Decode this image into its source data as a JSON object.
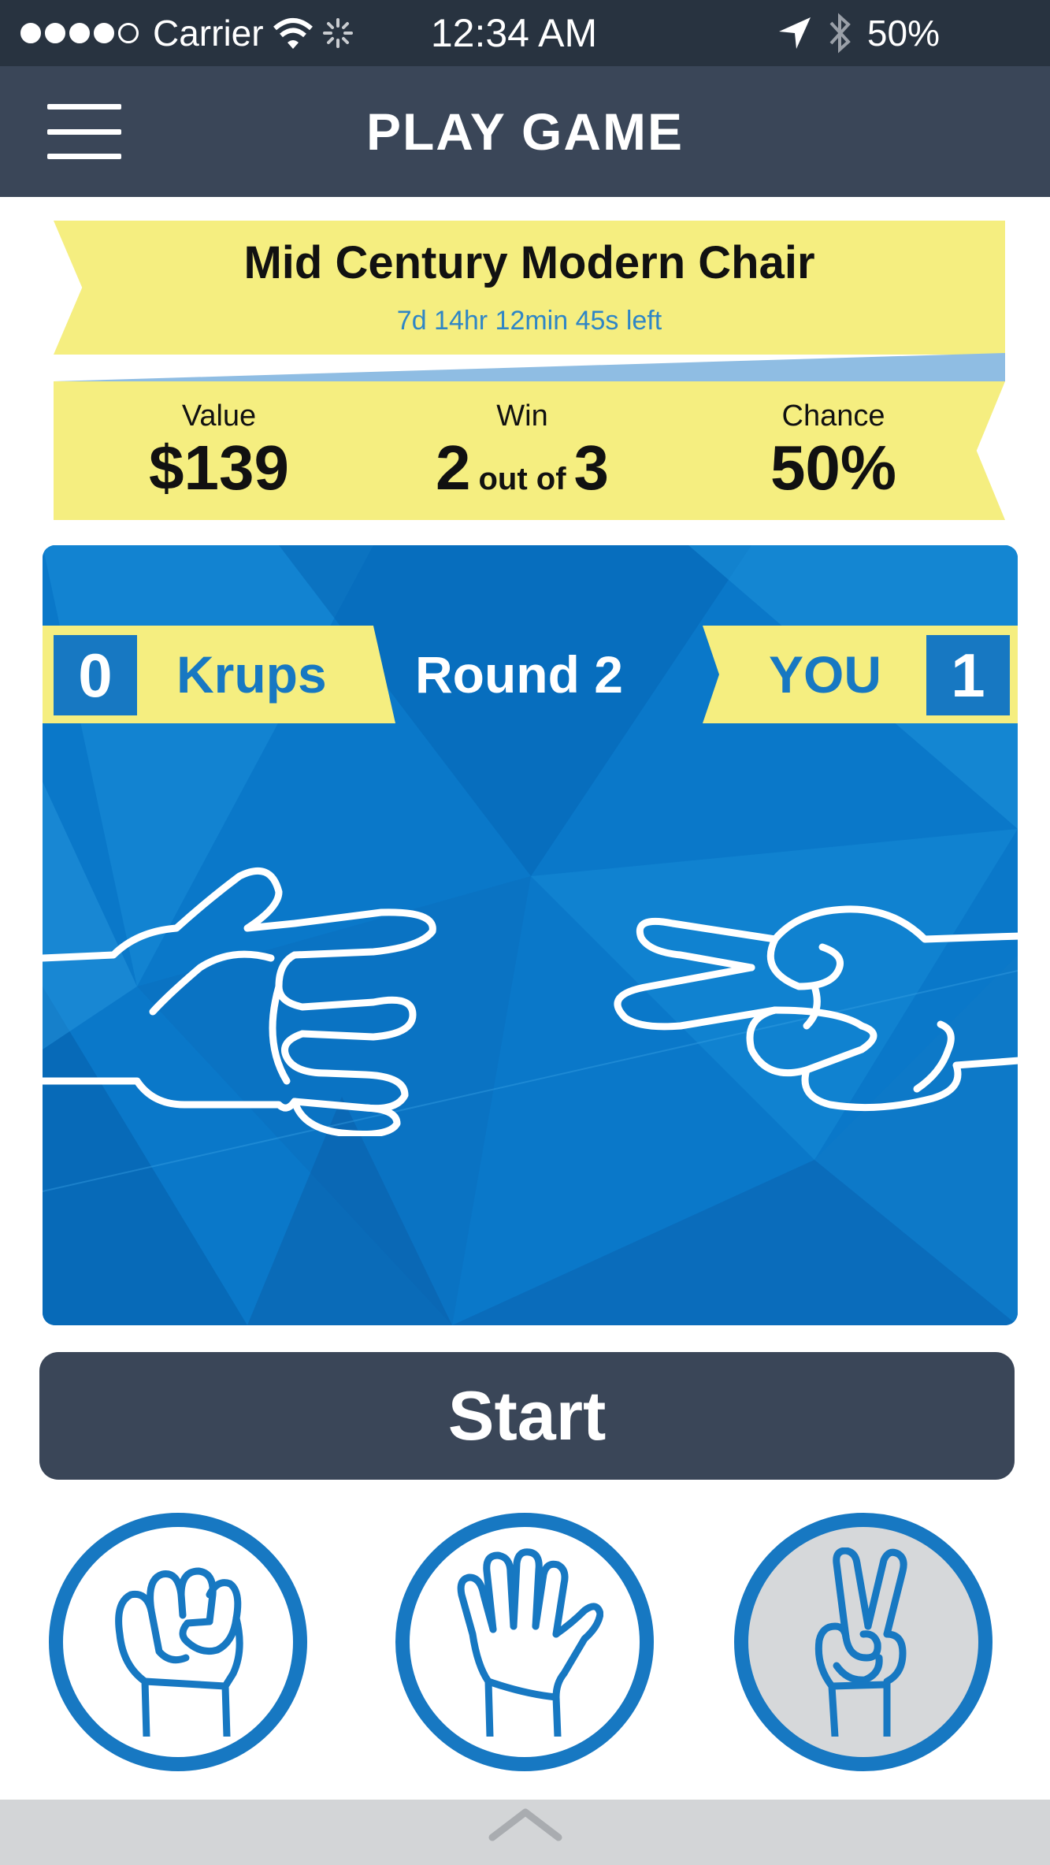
{
  "status_bar": {
    "carrier": "Carrier",
    "time": "12:34 AM",
    "battery": "50%"
  },
  "nav": {
    "title": "PLAY GAME"
  },
  "product": {
    "title": "Mid Century Modern Chair",
    "time_left": "7d 14hr 12min 45s left"
  },
  "stats": {
    "value_label": "Value",
    "value": "$139",
    "win_label": "Win",
    "win_needed": "2",
    "win_connector": "out of",
    "win_total": "3",
    "chance_label": "Chance",
    "chance": "50%"
  },
  "game": {
    "opponent_score": "0",
    "opponent_name": "Krups",
    "round": "Round 2",
    "player_name": "YOU",
    "player_score": "1",
    "opponent_hand": "paper-hand-icon",
    "player_hand": "scissors-hand-icon"
  },
  "start_label": "Start",
  "choices": [
    {
      "name": "rock",
      "icon": "rock-hand-icon",
      "selected": false
    },
    {
      "name": "paper",
      "icon": "paper-hand-icon",
      "selected": false
    },
    {
      "name": "scissors",
      "icon": "scissors-hand-icon",
      "selected": true
    }
  ],
  "colors": {
    "nav_dark": "#3a4658",
    "status_dark": "#283340",
    "banner_yellow": "#f5ee80",
    "game_blue": "#0a78c9",
    "accent_blue": "#1778c2"
  }
}
